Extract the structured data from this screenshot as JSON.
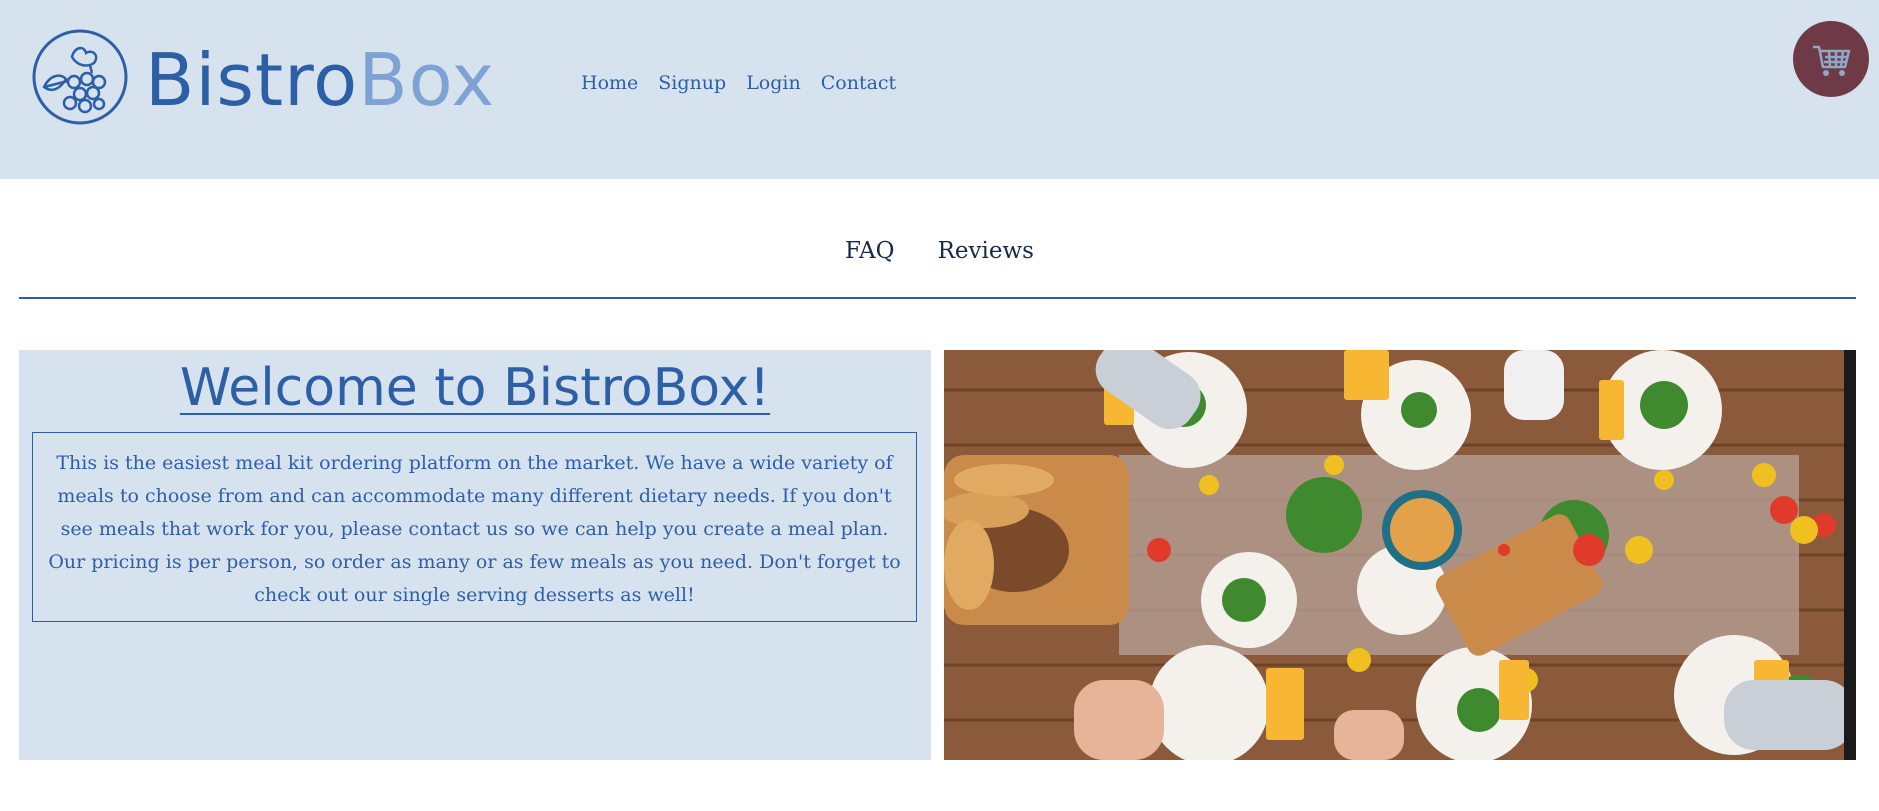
{
  "header": {
    "logo": {
      "text_dark": "Bistro",
      "text_light": "Box"
    },
    "nav": [
      {
        "label": "Home"
      },
      {
        "label": "Signup"
      },
      {
        "label": "Login"
      },
      {
        "label": "Contact"
      }
    ],
    "cart_icon": "shopping-cart-icon"
  },
  "subnav": [
    {
      "label": "FAQ"
    },
    {
      "label": "Reviews"
    }
  ],
  "welcome": {
    "title": "Welcome to BistroBox!",
    "body": "This is the easiest meal kit ordering platform on the market. We have a wide variety of meals to choose from and can accommodate many different dietary needs. If you don't see meals that work for you, please contact us so we can help you create a meal plan. Our pricing is per person, so order as many or as few meals as you need. Don't forget to check out our single serving desserts as well!"
  },
  "colors": {
    "header_bg": "#d7e2ef",
    "accent_blue": "#2d5fa6",
    "light_blue": "#7fa2d4",
    "cart_bg": "#6e3a46"
  }
}
